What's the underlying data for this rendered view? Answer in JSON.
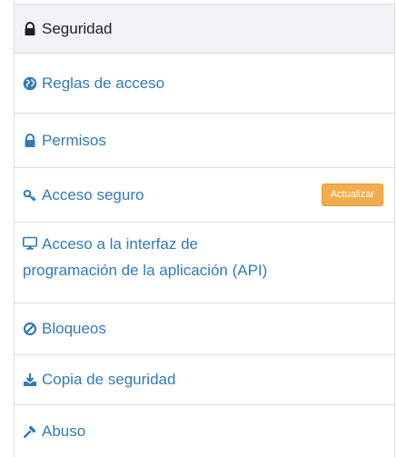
{
  "colors": {
    "link": "#337ab7",
    "active_bg": "#f2f2f8",
    "active_text": "#222222",
    "badge": "#f0ad4e",
    "border": "#dddddd"
  },
  "menu": {
    "items": [
      {
        "label": "Seguridad",
        "icon": "lock-icon",
        "active": true
      },
      {
        "label": "Reglas de acceso",
        "icon": "globe-icon"
      },
      {
        "label": "Permisos",
        "icon": "lock-icon"
      },
      {
        "label": "Acceso seguro",
        "icon": "key-icon",
        "badge": "Actualizar"
      },
      {
        "label_line1": "Acceso a la interfaz de",
        "label_line2": "programación de la aplicación (API)",
        "icon": "monitor-icon"
      },
      {
        "label": "Bloqueos",
        "icon": "ban-icon"
      },
      {
        "label": "Copia de seguridad",
        "icon": "download-icon"
      },
      {
        "label": "Abuso",
        "icon": "gavel-icon"
      }
    ]
  }
}
